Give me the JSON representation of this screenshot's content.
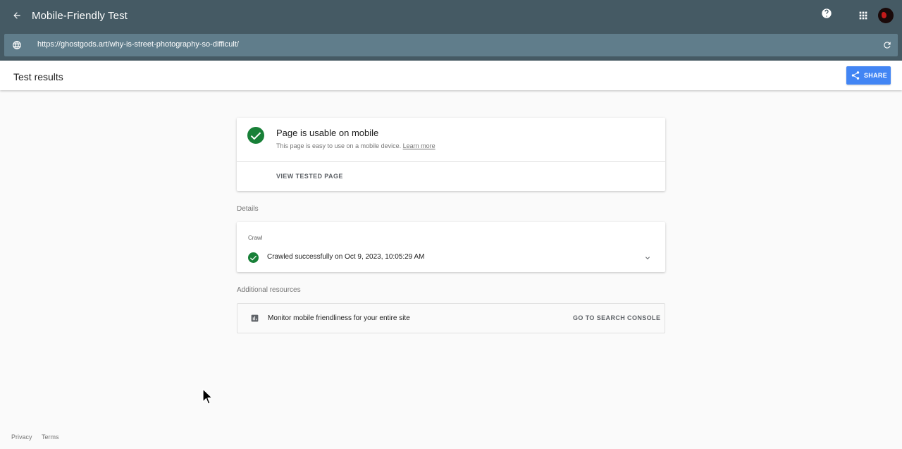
{
  "appbar": {
    "title": "Mobile-Friendly Test",
    "back_icon": "arrow-back-icon",
    "help_icon": "help-icon",
    "apps_icon": "apps-grid-icon"
  },
  "urlbar": {
    "url": "https://ghostgods.art/why-is-street-photography-so-difficult/",
    "globe_icon": "globe-icon",
    "reload_icon": "reload-icon"
  },
  "results_header": {
    "title": "Test results",
    "share_label": "SHARE"
  },
  "result": {
    "heading": "Page is usable on mobile",
    "description": "This page is easy to use on a mobile device.",
    "learn_more": "Learn more",
    "view_tested_page": "VIEW TESTED PAGE",
    "status_color": "#188038"
  },
  "details": {
    "section_label": "Details",
    "crawl_label": "Crawl",
    "crawl_status": "Crawled successfully on Oct 9, 2023, 10:05:29 AM"
  },
  "additional": {
    "section_label": "Additional resources",
    "resource_text": "Monitor mobile friendliness for your entire site",
    "console_label": "GO TO SEARCH CONSOLE"
  },
  "footer": {
    "privacy": "Privacy",
    "terms": "Terms"
  },
  "colors": {
    "appbar": "#455a64",
    "urlbar": "#607d8b",
    "accent": "#4285f4",
    "success": "#188038"
  }
}
